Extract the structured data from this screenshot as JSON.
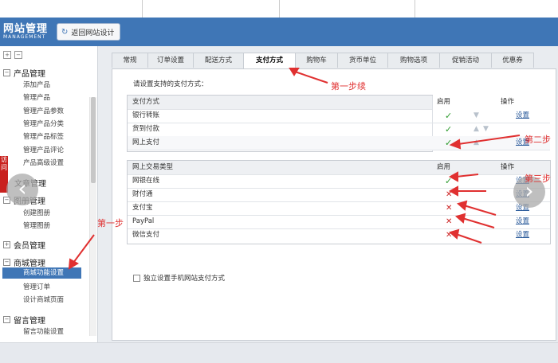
{
  "header": {
    "logo_cn": "网站管理",
    "logo_en": "MANAGEMENT",
    "back_button": "返回网站设计"
  },
  "sidebar": {
    "sections": [
      {
        "label": "产品管理",
        "items": [
          "添加产品",
          "管理产品",
          "管理产品参数",
          "管理产品分类",
          "管理产品标签",
          "管理产品评论",
          "产品高级设置"
        ]
      },
      {
        "label": "文章管理",
        "items": []
      },
      {
        "label": "图册管理",
        "items": [
          "创建图册",
          "管理图册"
        ]
      },
      {
        "label": "会员管理",
        "items": []
      },
      {
        "label": "商城管理",
        "items": [
          "商城功能设置",
          "管理订单",
          "设计商城页面"
        ]
      },
      {
        "label": "留言管理",
        "items": [
          "留言功能设置"
        ]
      }
    ],
    "red_tab": "访问"
  },
  "tabs": [
    "常规",
    "订单设置",
    "配送方式",
    "支付方式",
    "购物车",
    "货币单位",
    "购物选项",
    "促销活动",
    "优惠券"
  ],
  "active_tab": "支付方式",
  "panel": {
    "prompt": "请设置支持的支付方式：",
    "table1": {
      "headers": [
        "支付方式",
        "启用",
        "操作"
      ],
      "rows": [
        {
          "name": "银行转账",
          "enabled": "✓",
          "action": "设置"
        },
        {
          "name": "货到付款",
          "enabled": "✓",
          "action": ""
        },
        {
          "name": "网上支付",
          "enabled": "✓",
          "action": "设置"
        }
      ]
    },
    "table2": {
      "headers": [
        "网上交易类型",
        "启用",
        "操作"
      ],
      "rows": [
        {
          "name": "网银在线",
          "enabled": "✓",
          "action": "设置"
        },
        {
          "name": "财付通",
          "enabled": "✕",
          "action": "设置"
        },
        {
          "name": "支付宝",
          "enabled": "✕",
          "action": "设置"
        },
        {
          "name": "PayPal",
          "enabled": "✕",
          "action": "设置"
        },
        {
          "name": "微信支付",
          "enabled": "✕",
          "action": "设置"
        }
      ]
    },
    "checkbox_label": "独立设置手机网站支付方式"
  },
  "annotations": {
    "step1": "第一步",
    "step1_cont": "第一步续",
    "step2": "第二步",
    "step3": "第三步"
  },
  "colors": {
    "header": "#3f76b6",
    "enabled_green": "#2c9a2c",
    "disabled_red": "#cc2222",
    "annotation_red": "#e03030"
  }
}
